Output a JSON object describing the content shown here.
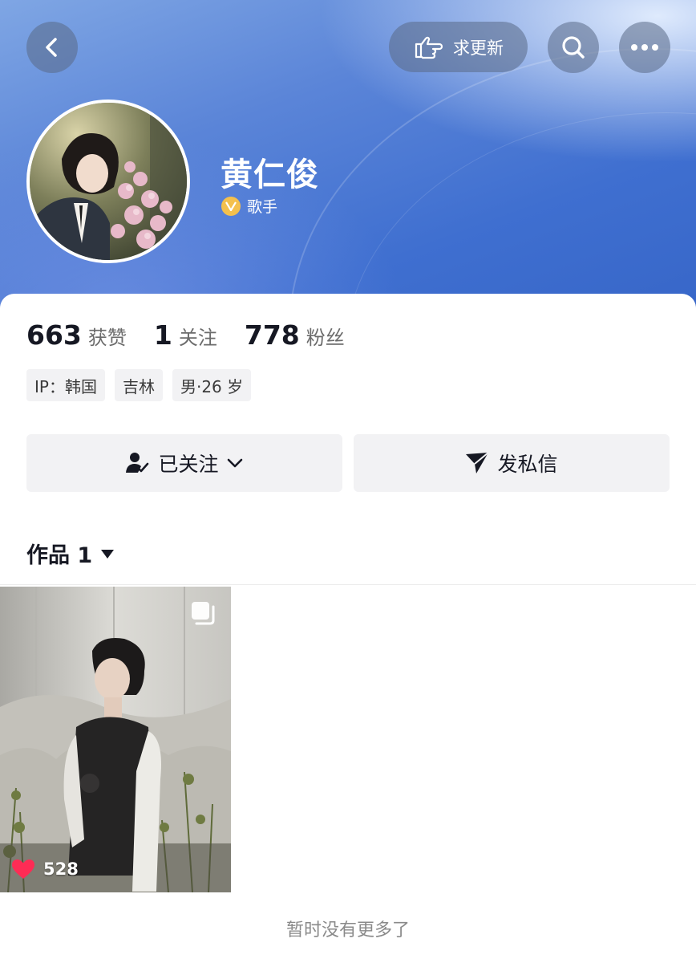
{
  "header": {
    "back_icon": "chevron-left-icon",
    "request_update_label": "求更新",
    "request_update_icon": "pointing-hand-icon",
    "search_icon": "search-icon",
    "more_icon": "more-dots-icon"
  },
  "profile": {
    "name": "黄仁俊",
    "verified_icon": "verified-v-badge-icon",
    "role": "歌手"
  },
  "stats": [
    {
      "value": "663",
      "label": "获赞"
    },
    {
      "value": "1",
      "label": "关注"
    },
    {
      "value": "778",
      "label": "粉丝"
    }
  ],
  "tags": [
    "IP：韩国",
    "吉林",
    "男·26 岁"
  ],
  "actions": {
    "follow_label": "已关注",
    "follow_icon": "user-check-icon",
    "dropdown_icon": "chevron-down-icon",
    "message_label": "发私信",
    "message_icon": "send-icon"
  },
  "works": {
    "label": "作品 1",
    "sort_icon": "triangle-down-icon"
  },
  "posts": [
    {
      "likes": "528",
      "multi_image": true
    }
  ],
  "footer": {
    "no_more": "暂时没有更多了"
  },
  "colors": {
    "header_blue": "#3f6fd0",
    "like_red": "#fe2c55",
    "badge_gold": "#f4c04d",
    "button_gray": "#f2f2f4"
  }
}
